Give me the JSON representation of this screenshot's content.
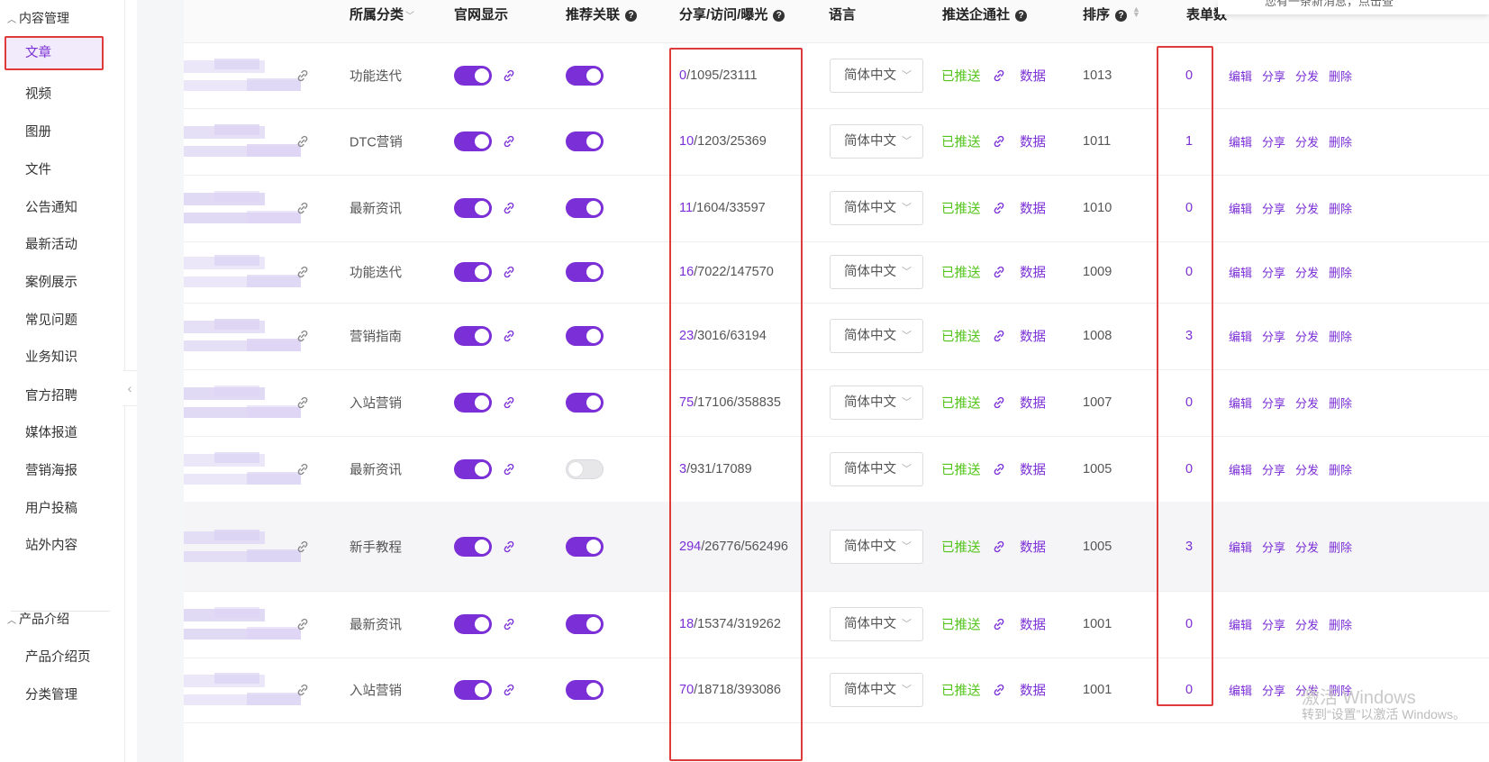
{
  "sidebar": {
    "group1": "内容管理",
    "items": [
      "文章",
      "视频",
      "图册",
      "文件",
      "公告通知",
      "最新活动",
      "案例展示",
      "常见问题",
      "业务知识",
      "官方招聘",
      "媒体报道",
      "营销海报",
      "用户投稿",
      "站外内容"
    ],
    "group2": "产品介绍",
    "group2_items": [
      "产品介绍页",
      "分类管理"
    ]
  },
  "table": {
    "headers": {
      "category": "所属分类",
      "site_display": "官网显示",
      "recommend": "推荐关联",
      "stats": "分享/访问/曝光",
      "language": "语言",
      "push": "推送企通社",
      "order": "排序",
      "forms": "表单数"
    },
    "rows": [
      {
        "category": "功能迭代",
        "site": true,
        "recommend": true,
        "share": "0",
        "rest": "/1095/23111",
        "lang": "简体中文",
        "pushed": "已推送",
        "data": "数据",
        "order": "1013",
        "forms": "0"
      },
      {
        "category": "DTC营销",
        "site": true,
        "recommend": true,
        "share": "10",
        "rest": "/1203/25369",
        "lang": "简体中文",
        "pushed": "已推送",
        "data": "数据",
        "order": "1011",
        "forms": "1"
      },
      {
        "category": "最新资讯",
        "site": true,
        "recommend": true,
        "share": "11",
        "rest": "/1604/33597",
        "lang": "简体中文",
        "pushed": "已推送",
        "data": "数据",
        "order": "1010",
        "forms": "0"
      },
      {
        "category": "功能迭代",
        "site": true,
        "recommend": true,
        "share": "16",
        "rest": "/7022/147570",
        "lang": "简体中文",
        "pushed": "已推送",
        "data": "数据",
        "order": "1009",
        "forms": "0"
      },
      {
        "category": "营销指南",
        "site": true,
        "recommend": true,
        "share": "23",
        "rest": "/3016/63194",
        "lang": "简体中文",
        "pushed": "已推送",
        "data": "数据",
        "order": "1008",
        "forms": "3"
      },
      {
        "category": "入站营销",
        "site": true,
        "recommend": true,
        "share": "75",
        "rest": "/17106/358835",
        "lang": "简体中文",
        "pushed": "已推送",
        "data": "数据",
        "order": "1007",
        "forms": "0"
      },
      {
        "category": "最新资讯",
        "site": true,
        "recommend": false,
        "share": "3",
        "rest": "/931/17089",
        "lang": "简体中文",
        "pushed": "已推送",
        "data": "数据",
        "order": "1005",
        "forms": "0"
      },
      {
        "category": "新手教程",
        "site": true,
        "recommend": true,
        "share": "294",
        "rest": "/26776/562496",
        "lang": "简体中文",
        "pushed": "已推送",
        "data": "数据",
        "order": "1005",
        "forms": "3"
      },
      {
        "category": "最新资讯",
        "site": true,
        "recommend": true,
        "share": "18",
        "rest": "/15374/319262",
        "lang": "简体中文",
        "pushed": "已推送",
        "data": "数据",
        "order": "1001",
        "forms": "0"
      },
      {
        "category": "入站营销",
        "site": true,
        "recommend": true,
        "share": "70",
        "rest": "/18718/393086",
        "lang": "简体中文",
        "pushed": "已推送",
        "data": "数据",
        "order": "1001",
        "forms": "0"
      }
    ],
    "actions": {
      "edit": "编辑",
      "share": "分享",
      "distribute": "分发",
      "delete": "删除"
    }
  },
  "toast": {
    "text": "您有一条新消息，点击查"
  },
  "watermark": {
    "line1": "激活 Windows",
    "line2": "转到“设置”以激活 Windows。"
  },
  "colors": {
    "accent": "#7b2fd6",
    "success": "#52c41a",
    "highlight_frame": "#e03b3b"
  }
}
